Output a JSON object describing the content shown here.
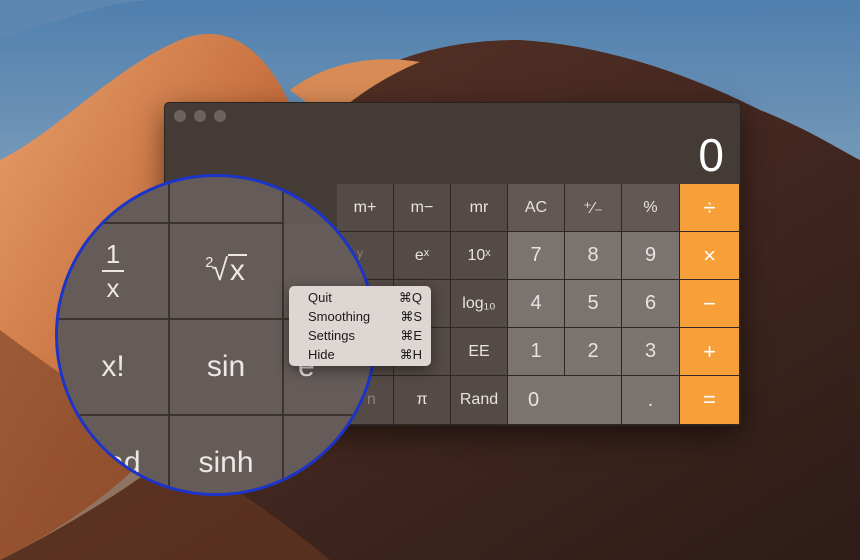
{
  "colors": {
    "operator": "#f7a039",
    "lens_ring": "#1c34c9"
  },
  "window": {
    "traffic_lights": [
      "close",
      "minimize",
      "zoom"
    ]
  },
  "display": {
    "value": "0"
  },
  "keys": {
    "m_plus": "m+",
    "m_minus": "m−",
    "mr": "mr",
    "ac": "AC",
    "plus_minus": "⁺∕₋",
    "percent": "%",
    "divide": "÷",
    "e_x": "eˣ",
    "ten_x": "10ˣ",
    "seven": "7",
    "eight": "8",
    "nine": "9",
    "multiply": "×",
    "log10": "log₁₀",
    "four": "4",
    "five": "5",
    "six": "6",
    "minus": "−",
    "ee": "EE",
    "one": "1",
    "two": "2",
    "three": "3",
    "plus": "+",
    "pi": "π",
    "rand": "Rand",
    "zero": "0",
    "decimal": ".",
    "equals": "=",
    "partial_y": "y",
    "partial_e": "e",
    "partial_n": "n"
  },
  "menu": {
    "items": [
      {
        "label": "Quit",
        "shortcut": "⌘Q"
      },
      {
        "label": "Smoothing",
        "shortcut": "⌘S"
      },
      {
        "label": "Settings",
        "shortcut": "⌘E"
      },
      {
        "label": "Hide",
        "shortcut": "⌘H"
      }
    ]
  },
  "lens": {
    "reciprocal_num": "1",
    "reciprocal_den": "x",
    "root_index": "2",
    "root_radicand": "x",
    "factorial": "x!",
    "sin": "sin",
    "rad": "Rad",
    "sinh": "sinh",
    "e_partial": "e"
  }
}
